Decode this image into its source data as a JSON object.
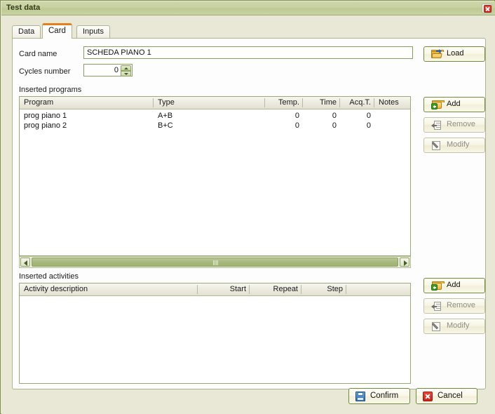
{
  "window": {
    "title": "Test data",
    "close_label": "×"
  },
  "tabs": [
    {
      "label": "Data",
      "active": false
    },
    {
      "label": "Card",
      "active": true
    },
    {
      "label": "Inputs",
      "active": false
    }
  ],
  "form": {
    "card_name_label": "Card name",
    "card_name_value": "SCHEDA PIANO 1",
    "cycles_label": "Cycles number",
    "cycles_value": "0"
  },
  "programs": {
    "section_label": "Inserted programs",
    "columns": [
      "Program",
      "Type",
      "Temp.",
      "Time",
      "Acq.T.",
      "Notes"
    ],
    "rows": [
      {
        "program": "prog piano 1",
        "type": "A+B",
        "temp": "0",
        "time": "0",
        "acqt": "0",
        "notes": ""
      },
      {
        "program": "prog piano 2",
        "type": "B+C",
        "temp": "0",
        "time": "0",
        "acqt": "0",
        "notes": ""
      }
    ],
    "buttons": [
      {
        "label": "Load",
        "icon": "folder-open-icon",
        "enabled": true
      },
      {
        "label": "Add",
        "icon": "folder-add-icon",
        "enabled": true
      },
      {
        "label": "Remove",
        "icon": "remove-icon",
        "enabled": false
      },
      {
        "label": "Modify",
        "icon": "pencil-icon",
        "enabled": false
      }
    ]
  },
  "activities": {
    "section_label": "Inserted activities",
    "columns": [
      "Activity description",
      "Start",
      "Repeat",
      "Step"
    ],
    "rows": [],
    "buttons": [
      {
        "label": "Add",
        "icon": "folder-add-icon",
        "enabled": true
      },
      {
        "label": "Remove",
        "icon": "remove-icon",
        "enabled": false
      },
      {
        "label": "Modify",
        "icon": "pencil-icon",
        "enabled": false
      }
    ]
  },
  "footer": {
    "confirm_label": "Confirm",
    "cancel_label": "Cancel"
  },
  "colors": {
    "titlebar": "#c6d0a0",
    "frame_border": "#7f9250",
    "body_bg": "#e9e8d7",
    "panel_bg": "#fdfdfd",
    "active_tab_accent": "#e2801e",
    "input_border": "#86a05f",
    "scrollbar_thumb": "#a6b87c",
    "enabled_button_border": "#6f8c3e",
    "disabled_text": "#8d8d85"
  }
}
